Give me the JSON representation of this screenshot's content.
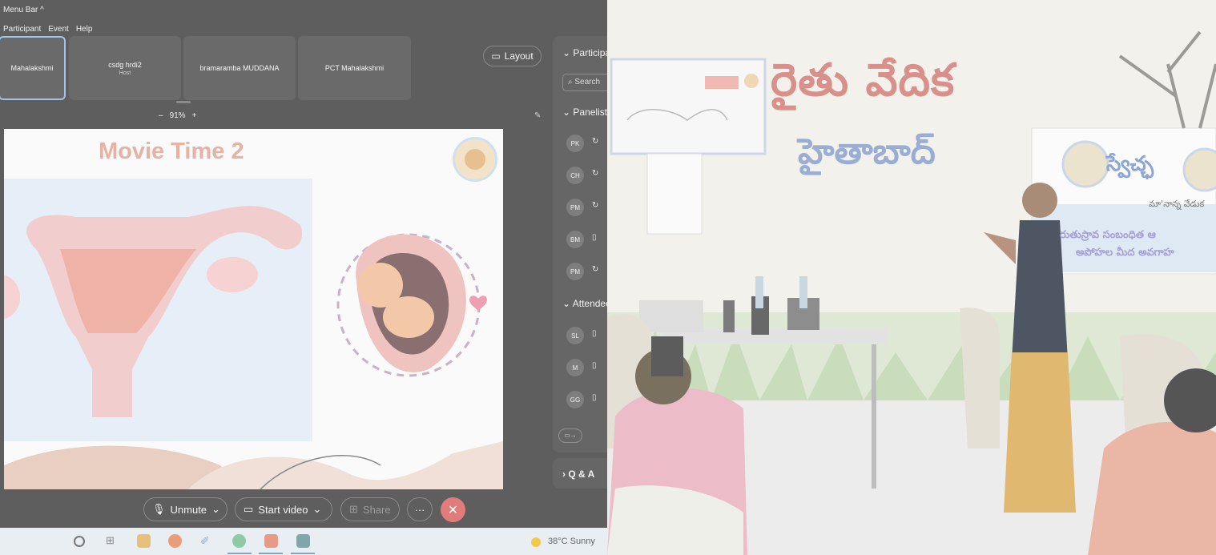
{
  "app": {
    "menu_bar_title": "Menu Bar ^",
    "menu_items": [
      "Participant",
      "Event",
      "Help"
    ]
  },
  "video_tiles": [
    {
      "name": "Mahalakshmi",
      "role": ""
    },
    {
      "name": "csdg hrdi2",
      "role": "Host"
    },
    {
      "name": "bramaramba MUDDANA",
      "role": ""
    },
    {
      "name": "PCT Mahalakshmi",
      "role": ""
    }
  ],
  "toolbar": {
    "layout_label": "Layout",
    "zoom_minus": "–",
    "zoom_value": "91%",
    "zoom_plus": "+"
  },
  "slide": {
    "title": "Movie Time 2"
  },
  "panel": {
    "participants_header": "Participants",
    "search_placeholder": "Search",
    "panelists_header": "Panelists",
    "panelists": [
      {
        "initials": "PK",
        "status": "sync-icon"
      },
      {
        "initials": "CH",
        "status": "sync-icon"
      },
      {
        "initials": "PM",
        "status": "sync-icon"
      },
      {
        "initials": "BM",
        "status": "phone-icon"
      },
      {
        "initials": "PM",
        "status": "sync-icon"
      }
    ],
    "attendees_header": "Attendees",
    "attendees": [
      {
        "initials": "SL",
        "status": "phone-icon"
      },
      {
        "initials": "M",
        "status": "phone-icon"
      },
      {
        "initials": "GG",
        "status": "phone-icon"
      }
    ],
    "qa_label": "Q & A"
  },
  "controls": {
    "unmute_label": "Unmute",
    "start_video_label": "Start video",
    "share_label": "Share",
    "more_label": "···",
    "end_label": "✕"
  },
  "taskbar": {
    "weather_text": "38°C  Sunny"
  },
  "photo": {
    "sign_line1": "రైతు వేదిక",
    "sign_line2": "హైతాబాద్",
    "banner_title": "స్వేచ్ఛ",
    "banner_sub": "మా'నాన్న వేడుక",
    "banner_line1": "రుతుస్రావ సంబంధిత ఆ",
    "banner_line2": "అపోహల మీద అవగాహ"
  },
  "colors": {
    "end_call": "#e07c7c",
    "slide_title": "#e7b1a5",
    "sign_red": "#d98f8a",
    "sign_blue": "#9aaed4"
  }
}
